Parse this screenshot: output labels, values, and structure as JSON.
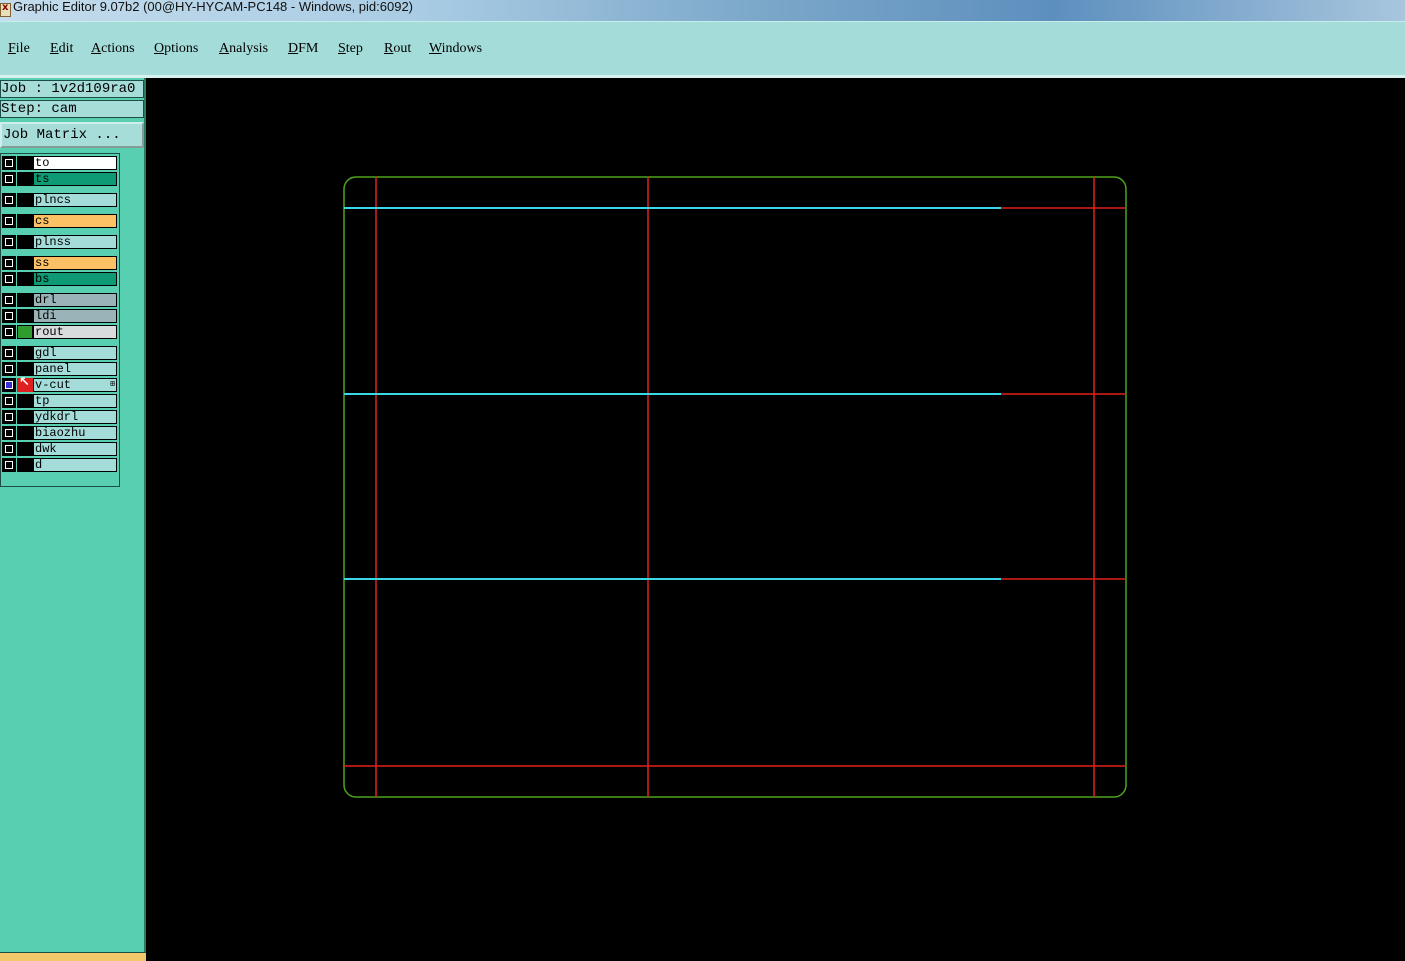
{
  "window": {
    "title": "Graphic Editor 9.07b2 (00@HY-HYCAM-PC148 - Windows, pid:6092)"
  },
  "menu": {
    "items": [
      "File",
      "Edit",
      "Actions",
      "Options",
      "Analysis",
      "DFM",
      "Step",
      "Rout",
      "Windows"
    ]
  },
  "job_panel": {
    "job_label": "Job : 1v2d109ra0",
    "step_label": "Step: cam",
    "job_matrix_label": "Job Matrix ..."
  },
  "layers": [
    {
      "name": "to",
      "color": "#ffffff",
      "checked": false,
      "swatch": "none"
    },
    {
      "name": "ts",
      "color": "#0e9a74",
      "checked": false,
      "swatch": "none"
    },
    {
      "name": "plncs",
      "color": "#a3dcd9",
      "checked": false,
      "swatch": "none"
    },
    {
      "name": "cs",
      "color": "#fbc164",
      "checked": false,
      "swatch": "none"
    },
    {
      "name": "plnss",
      "color": "#a3dcd9",
      "checked": false,
      "swatch": "none"
    },
    {
      "name": "ss",
      "color": "#fbc164",
      "checked": false,
      "swatch": "none"
    },
    {
      "name": "bs",
      "color": "#0e9a74",
      "checked": false,
      "swatch": "none"
    },
    {
      "name": "drl",
      "color": "#9ab3b8",
      "checked": false,
      "swatch": "none"
    },
    {
      "name": "ldi",
      "color": "#9ab3b8",
      "checked": false,
      "swatch": "none"
    },
    {
      "name": "rout",
      "color": "#d8dcdc",
      "checked": false,
      "swatch": "green"
    },
    {
      "name": "gdl",
      "color": "#a3dcd9",
      "checked": false,
      "swatch": "none"
    },
    {
      "name": "panel",
      "color": "#a3dcd9",
      "checked": false,
      "swatch": "none"
    },
    {
      "name": "v-cut",
      "color": "#a3dcd9",
      "checked": true,
      "swatch": "arrow",
      "mark": "⊞"
    },
    {
      "name": "tp",
      "color": "#a3dcd9",
      "checked": false,
      "swatch": "none"
    },
    {
      "name": "ydkdrl",
      "color": "#a3dcd9",
      "checked": false,
      "swatch": "none"
    },
    {
      "name": "biaozhu",
      "color": "#a3dcd9",
      "checked": false,
      "swatch": "none"
    },
    {
      "name": "dwk",
      "color": "#a3dcd9",
      "checked": false,
      "swatch": "none"
    },
    {
      "name": "d",
      "color": "#a3dcd9",
      "checked": false,
      "swatch": "none"
    }
  ],
  "colors": {
    "outline": "#4fa31c",
    "rout_lines": "#e0201a",
    "vcut_lines": "#3ad8e6",
    "canvas_bg": "#000000"
  }
}
